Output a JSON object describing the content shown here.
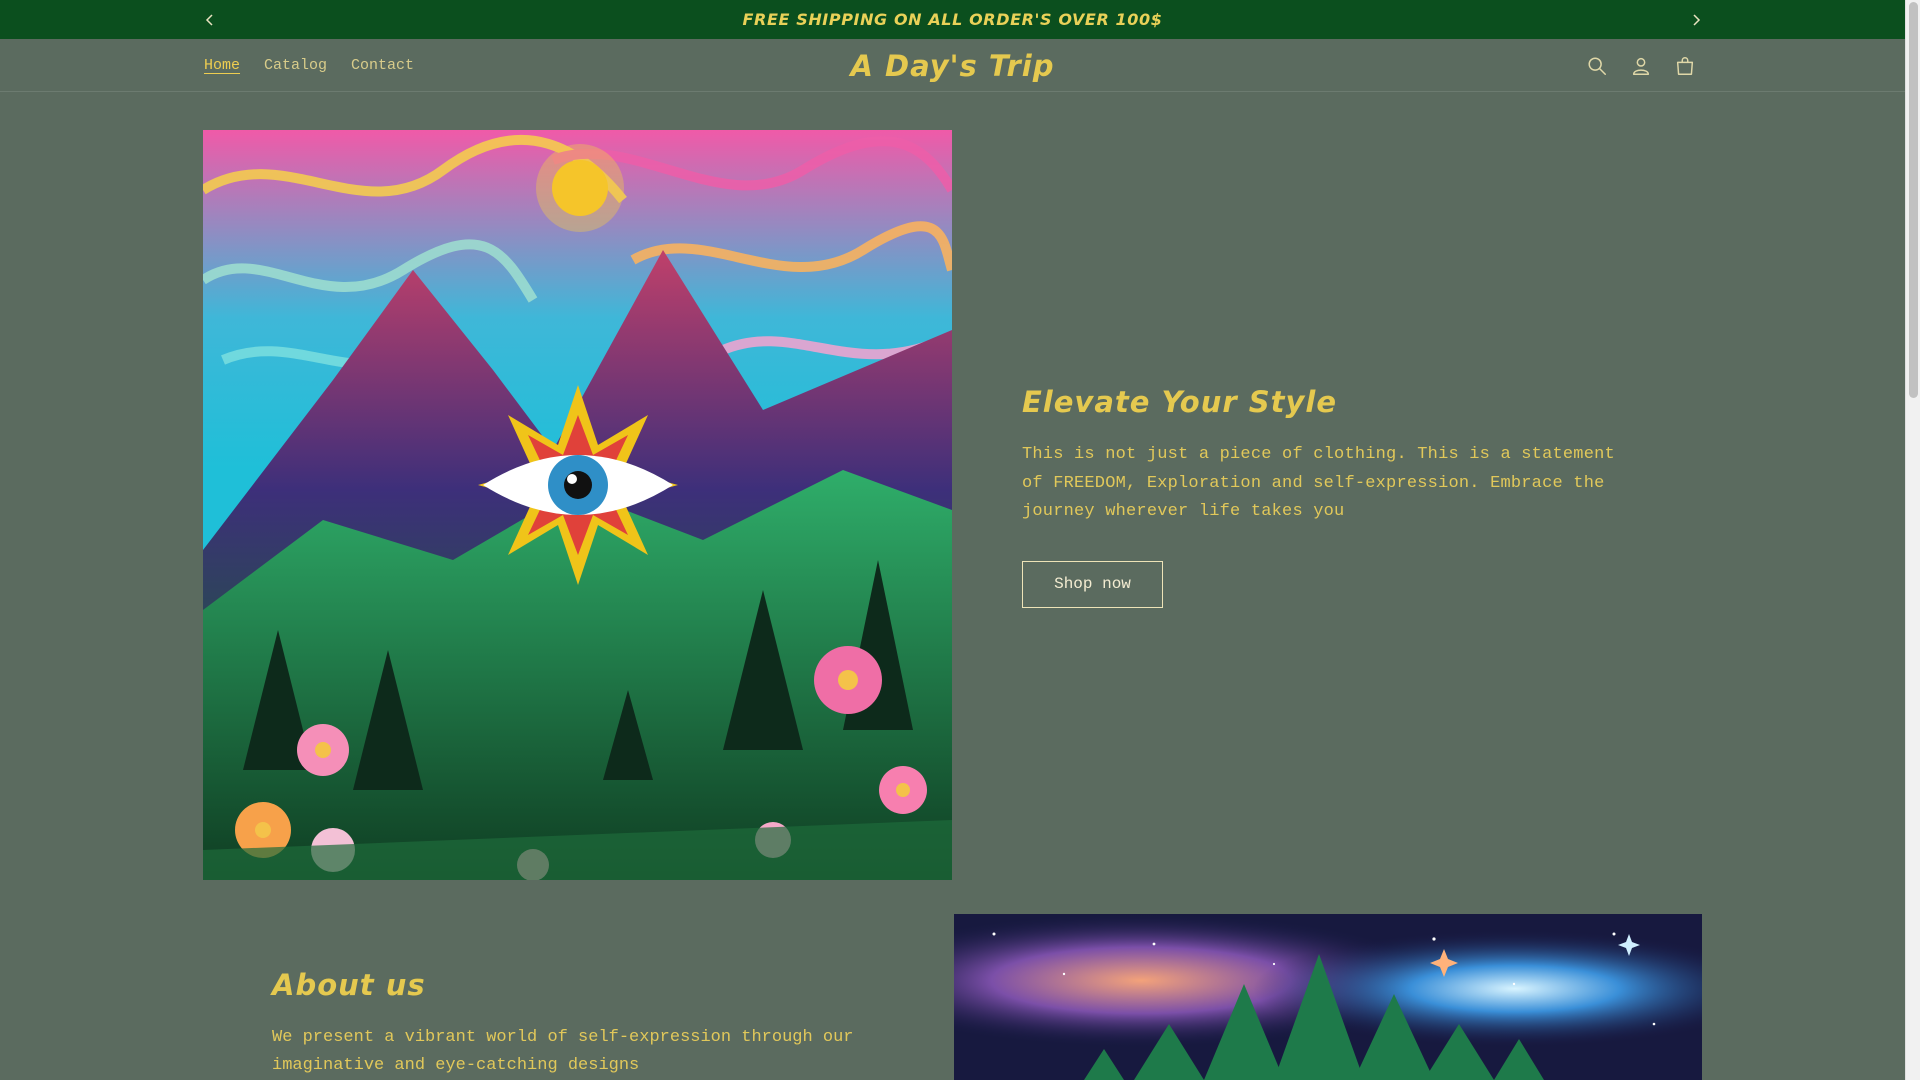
{
  "announcement": {
    "text": "FREE SHIPPING ON ALL ORDER'S OVER 100$",
    "prev_icon": "chevron-left-icon",
    "next_icon": "chevron-right-icon"
  },
  "header": {
    "logo": "A Day's Trip",
    "nav": [
      {
        "label": "Home",
        "active": true
      },
      {
        "label": "Catalog",
        "active": false
      },
      {
        "label": "Contact",
        "active": false
      }
    ],
    "icons": [
      "search-icon",
      "account-icon",
      "cart-icon"
    ]
  },
  "hero": {
    "image_icon": "psychedelic-mountain-eye-artwork",
    "title": "Elevate Your Style",
    "description": "This is not just a piece of clothing. This is a statement of FREEDOM, Exploration and self-expression. Embrace the journey wherever life takes you",
    "button_label": "Shop now"
  },
  "about": {
    "title": "About us",
    "description": "We present a vibrant world of self-expression through our imaginative and eye-catching designs",
    "image_icon": "galaxy-pine-forest-artwork"
  },
  "colors": {
    "page_bg": "#5b6b5f",
    "announcement_bg": "#0b4f1e",
    "accent": "#e5c94f"
  }
}
